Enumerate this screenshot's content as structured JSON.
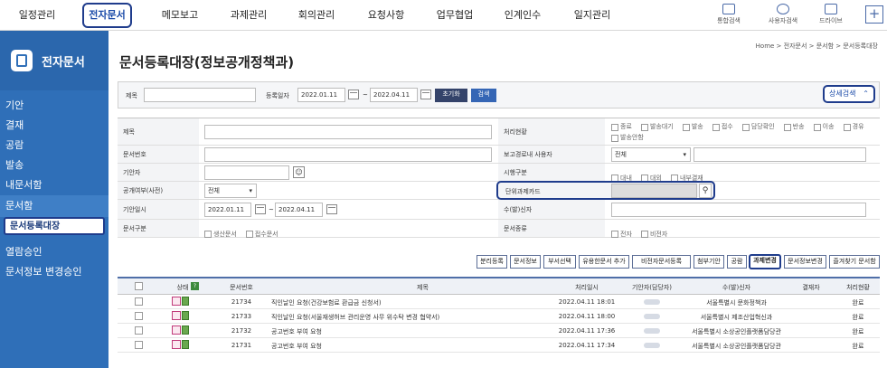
{
  "topnav": {
    "menus": [
      "일정관리",
      "전자문서",
      "메모보고",
      "과제관리",
      "회의관리",
      "요청사항",
      "업무협업",
      "인계인수",
      "일지관리"
    ],
    "tools": [
      "통합검색",
      "사용자검색",
      "드라이브"
    ],
    "plus": "+"
  },
  "sidebar": {
    "title": "전자문서",
    "items": [
      "기안",
      "결재",
      "공람",
      "발송",
      "내문서함",
      "문서함",
      "문서등록대장",
      "열람승인",
      "문서정보 변경승인"
    ]
  },
  "breadcrumb": "Home > 전자문서 > 문서함 > 문서등록대장",
  "page_title": "문서등록대장(정보공개정책과)",
  "search": {
    "title_label": "제목",
    "date_label": "등록일자",
    "date_from": "2022.01.11",
    "date_to": "2022.04.11",
    "tilde": "~",
    "reset_label": "초기화",
    "search_label": "검색",
    "advanced_label": "상세검색"
  },
  "form": {
    "title_label": "제목",
    "status_label": "처리현황",
    "status_options": [
      "종료",
      "발송대기",
      "발송",
      "접수",
      "담당확인",
      "반송",
      "이송",
      "경유",
      "발송안함"
    ],
    "docno_label": "문서번호",
    "report_user_label": "보고경로내 사용자",
    "report_user_value": "전체",
    "drafter_label": "기안자",
    "enforce_label": "시행구분",
    "enforce_options": [
      "대내",
      "대외",
      "내부결재"
    ],
    "open_label": "공개여부(사전)",
    "open_value": "전체",
    "unit_card_label": "단위과제카드",
    "draft_date_label": "기안일시",
    "draft_from": "2022.01.11",
    "draft_to": "2022.04.11",
    "tilde": "~",
    "receiver_label": "수(발)신자",
    "doc_type_label": "문서구분",
    "doc_type_options": [
      "생산문서",
      "접수문서"
    ],
    "doc_kind_label": "문서종류",
    "doc_kind_options": [
      "전자",
      "비전자"
    ]
  },
  "actions": [
    "분리등록",
    "문서정보",
    "부서선택",
    "유용한문서 추가",
    "비전자문서등록",
    "첨부기안",
    "공람",
    "과제변경",
    "문서정보변경",
    "즐겨찾기 문서함"
  ],
  "table": {
    "headers": [
      "상태",
      "문서번호",
      "제목",
      "처리일시",
      "기안자(담당자)",
      "수(발)신자",
      "결재자",
      "처리현황"
    ],
    "rows": [
      {
        "no": "21734",
        "title": "직인날인 요청(건강보험료 환급금 신청서)",
        "date": "2022.04.11 18:01",
        "receiver": "서울특별시 문화정책과",
        "status": "완료"
      },
      {
        "no": "21733",
        "title": "직인날인 요청(서울재생허브 관리운영 사무 위수탁 변경 협약서)",
        "date": "2022.04.11 18:00",
        "receiver": "서울특별시 제조산업혁신과",
        "status": "완료"
      },
      {
        "no": "21732",
        "title": "공고번호 부여 요청",
        "date": "2022.04.11 17:36",
        "receiver": "서울특별시 소상공인플랫폼담당관",
        "status": "완료"
      },
      {
        "no": "21731",
        "title": "공고번호 부여 요청",
        "date": "2022.04.11 17:34",
        "receiver": "서울특별시 소상공인플랫폼담당관",
        "status": "완료"
      }
    ]
  },
  "colors": {
    "sidebar": "#2f6fb8",
    "highlight": "#1f3c8c",
    "header_line": "#4f6fa8"
  }
}
